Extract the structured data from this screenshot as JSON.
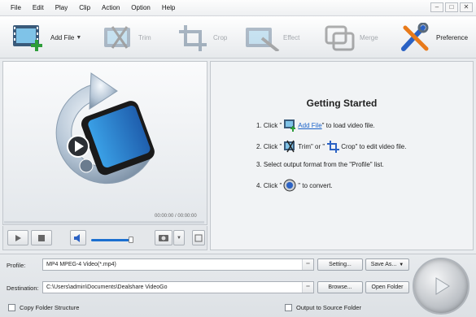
{
  "menu": [
    "File",
    "Edit",
    "Play",
    "Clip",
    "Action",
    "Option",
    "Help"
  ],
  "toolbar": {
    "add_file": "Add File",
    "trim": "Trim",
    "crop": "Crop",
    "effect": "Effect",
    "merge": "Merge",
    "preference": "Preference"
  },
  "player": {
    "time": "00:00:00 / 00:00:00",
    "volume_level": 0.95
  },
  "guide": {
    "title": "Getting Started",
    "step1": {
      "pre": "1. Click \"",
      "link": "Add File",
      "post": "\" to load video file."
    },
    "step2": {
      "pre": "2. Click \"",
      "mid": "Trim\" or \"",
      "post": "Crop\" to edit video file."
    },
    "step3": "3. Select output format from the \"Profile\" list.",
    "step4": {
      "pre": "4. Click \"",
      "post": "\" to convert."
    }
  },
  "bottom": {
    "profile_label": "Profile:",
    "profile_value": "MP4 MPEG-4 Video(*.mp4)",
    "setting_btn": "Setting...",
    "save_as_btn": "Save As...",
    "destination_label": "Destination:",
    "destination_value": "C:\\Users\\admin\\Documents\\Dealshare VideoGo",
    "browse_btn": "Browse...",
    "open_folder_btn": "Open Folder",
    "copy_folder": "Copy Folder Structure",
    "output_source": "Output to Source Folder"
  },
  "colors": {
    "accent": "#1a62c9",
    "volume": "#1b6fd0"
  }
}
